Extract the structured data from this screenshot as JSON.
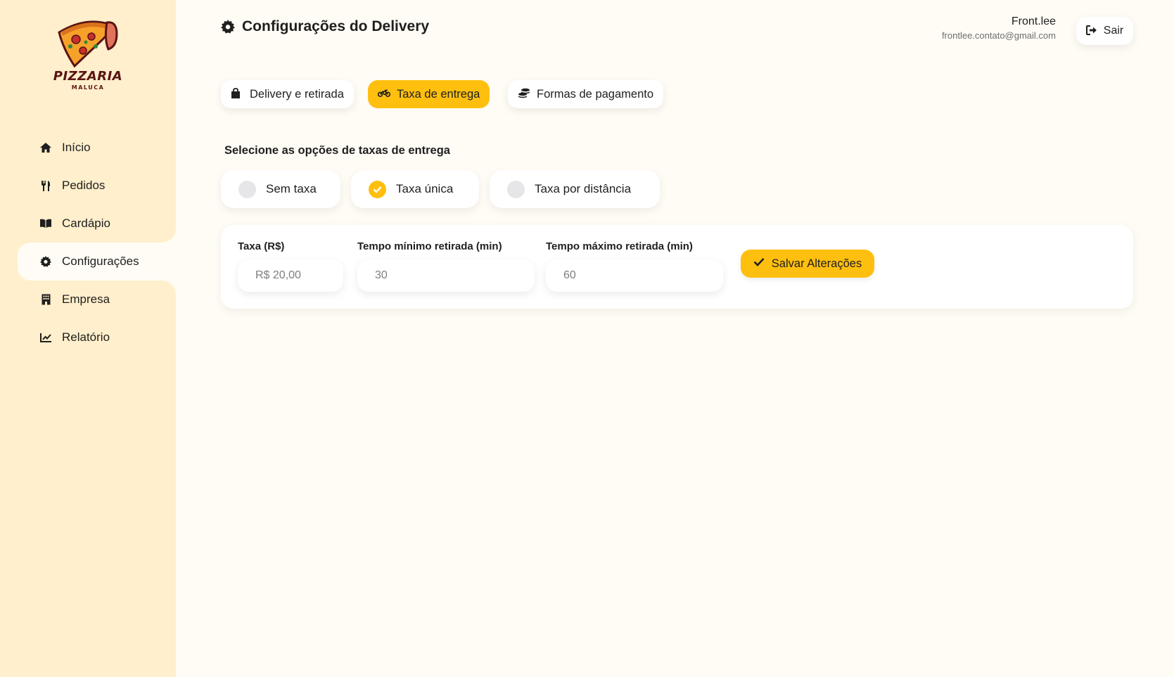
{
  "brand": {
    "name": "PIZZARIA",
    "subtitle": "MALUCA"
  },
  "sidebar": {
    "items": [
      {
        "label": "Início",
        "icon": "home-icon"
      },
      {
        "label": "Pedidos",
        "icon": "utensils-icon"
      },
      {
        "label": "Cardápio",
        "icon": "book-open-icon"
      },
      {
        "label": "Configurações",
        "icon": "gear-icon",
        "active": true
      },
      {
        "label": "Empresa",
        "icon": "building-icon"
      },
      {
        "label": "Relatório",
        "icon": "chart-line-icon"
      }
    ]
  },
  "header": {
    "title": "Configurações do Delivery",
    "user_name": "Front.lee",
    "user_email": "frontlee.contato@gmail.com",
    "logout_label": "Sair"
  },
  "tabs": [
    {
      "label": "Delivery e retirada",
      "icon": "shopping-bag-icon"
    },
    {
      "label": "Taxa de entrega",
      "icon": "motorcycle-icon",
      "active": true
    },
    {
      "label": "Formas de pagamento",
      "icon": "coins-icon"
    }
  ],
  "fee_section": {
    "label": "Selecione as opções de taxas de entrega",
    "options": [
      {
        "label": "Sem taxa",
        "checked": false
      },
      {
        "label": "Taxa única",
        "checked": true
      },
      {
        "label": "Taxa por distância",
        "checked": false
      }
    ]
  },
  "form": {
    "fee_label": "Taxa (R$)",
    "fee_value": "R$ 20,00",
    "min_time_label": "Tempo mínimo retirada (min)",
    "min_time_value": "30",
    "max_time_label": "Tempo máximo retirada (min)",
    "max_time_value": "60",
    "save_label": "Salvar Alterações"
  },
  "colors": {
    "accent": "#ffbf0f",
    "sidebar_bg": "#ffefcc",
    "page_bg": "#fffcf5"
  }
}
